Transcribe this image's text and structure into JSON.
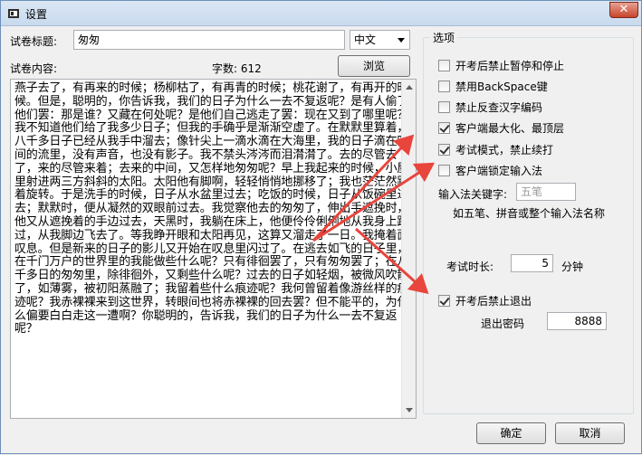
{
  "window": {
    "title": "设置",
    "close_glyph": "✕"
  },
  "exam": {
    "title_label": "试卷标题:",
    "title_value": "匆匆",
    "language_value": "中文",
    "content_label": "试卷内容:",
    "char_count_label": "字数: 612",
    "browse_label": "浏览",
    "content_text": "燕子去了，有再来的时候；杨柳枯了，有再青的时候；桃花谢了，有再开的时候。但是，聪明的，你告诉我，我们的日子为什么一去不复返呢？是有人偷了他们罢：那是谁？又藏在何处呢？是他们自己逃走了罢：现在又到了哪里呢？我不知道他们给了我多少日子；但我的手确乎是渐渐空虚了。在默默里算着，八千多日子已经从我手中溜去；像针尖上一滴水滴在大海里，我的日子滴在时间的流里，没有声音，也没有影子。我不禁头涔涔而泪潸潸了。去的尽管去了，来的尽管来着；去来的中间，又怎样地匆匆呢？早上我起来的时候，小屋里射进两三方斜斜的太阳。太阳他有脚啊，轻轻悄悄地挪移了；我也茫茫然跟着旋转。于是洗手的时候，日子从水盆里过去；吃饭的时候，日子从饭碗里过去；默默时，便从凝然的双眼前过去。我觉察他去的匆匆了，伸出手遮挽时，他又从遮挽着的手边过去，天黑时，我躺在床上，他便伶伶俐俐地从我身上跨过，从我脚边飞去了。等我睁开眼和太阳再见，这算又溜走了一日。我掩着面叹息。但是新来的日子的影儿又开始在叹息里闪过了。在逃去如飞的日子里，在千门万户的世界里的我能做些什么呢？只有徘徊罢了，只有匆匆罢了；在八千多日的匆匆里，除徘徊外，又剩些什么呢？过去的日子如轻烟，被微风吹散了，如薄雾，被初阳蒸融了；我留着些什么痕迹呢？我何曾留着像游丝样的痕迹呢？我赤裸裸来到这世界，转眼间也将赤裸裸的回去罢？但不能平的，为什么偏要白白走这一遭啊？你聪明的，告诉我，我们的日子为什么一去不复返呢？"
  },
  "options": {
    "group_title": "选项",
    "items": [
      {
        "label": "开考后禁止暂停和停止",
        "checked": false
      },
      {
        "label": "禁用BackSpace键",
        "checked": false
      },
      {
        "label": "禁止反查汉字编码",
        "checked": false
      },
      {
        "label": "客户端最大化、最顶层",
        "checked": true
      },
      {
        "label": "考试模式，禁止续打",
        "checked": true
      },
      {
        "label": "客户端锁定输入法",
        "checked": false
      }
    ],
    "ime_keyword_label": "输入法关键字:",
    "ime_keyword_placeholder": "五笔",
    "ime_hint": "如五笔、拼音或整个输入法名称",
    "duration_label": "考试时长:",
    "duration_value": "5",
    "duration_unit": "分钟",
    "forbid_exit_label": "开考后禁止退出",
    "forbid_exit_checked": true,
    "exit_password_label": "退出密码",
    "exit_password_value": "8888"
  },
  "buttons": {
    "ok_label": "确定",
    "cancel_label": "取消"
  },
  "colors": {
    "annotation_arrow": "#e8453c",
    "close_button": "#c7432a"
  }
}
